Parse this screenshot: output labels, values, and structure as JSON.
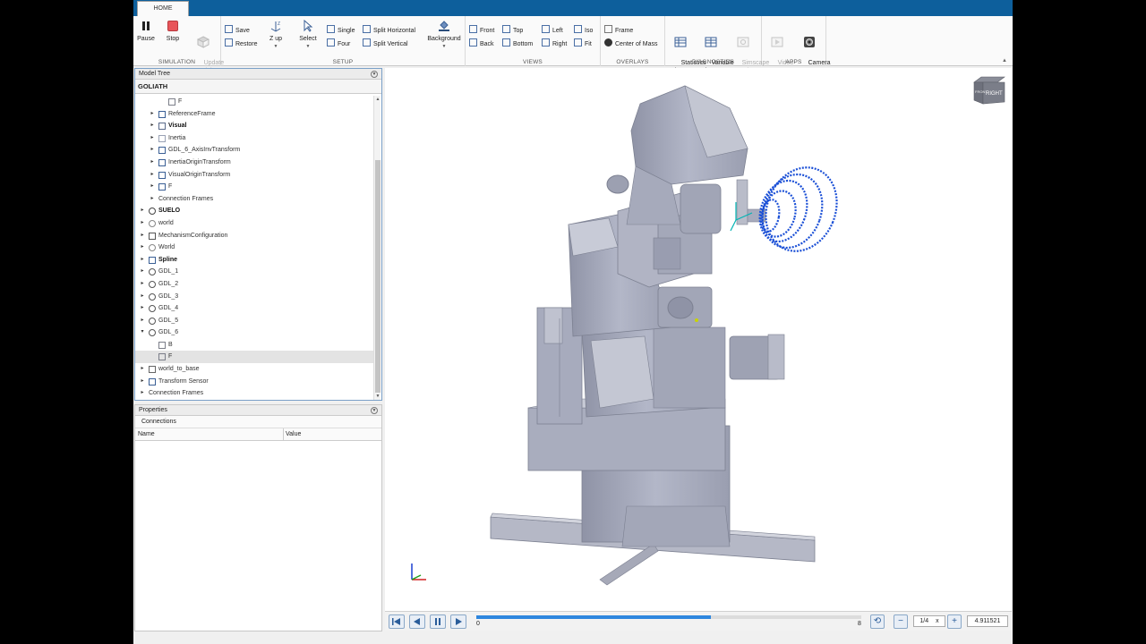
{
  "tabs": [
    {
      "label": "HOME"
    }
  ],
  "ribbon": {
    "simulation": {
      "label": "SIMULATION",
      "pause": "Pause",
      "stop": "Stop",
      "update_model": "Update\nModel"
    },
    "setup": {
      "label": "SETUP",
      "save": "Save",
      "restore": "Restore",
      "zup": "Z up",
      "select": "Select",
      "single": "Single",
      "four": "Four",
      "split_horizontal": "Split Horizontal",
      "split_vertical": "Split Vertical",
      "background": "Background"
    },
    "views": {
      "label": "VIEWS",
      "front": "Front",
      "back": "Back",
      "top": "Top",
      "bottom": "Bottom",
      "left": "Left",
      "right": "Right",
      "iso": "Iso",
      "fit": "Fit"
    },
    "overlays": {
      "label": "OVERLAYS",
      "frame": "Frame",
      "center_of_mass": "Center of Mass"
    },
    "diagnostics": {
      "label": "DIAGNOSTICS",
      "statistics_viewer": "Statistics\nViewer",
      "variable_viewer": "Variable\nViewer",
      "simscape_results": "Simscape\nResults"
    },
    "apps": {
      "label": "APPS",
      "video_creator": "Video\nCreator",
      "camera_manager": "Camera\nManager"
    }
  },
  "model_tree": {
    "title": "Model Tree",
    "root": "GOLIATH",
    "rows": [
      {
        "label": "F",
        "depth": 2,
        "arrow": "",
        "icon": "frame",
        "bold": false,
        "selected": false
      },
      {
        "label": "ReferenceFrame",
        "depth": 1,
        "arrow": "▸",
        "icon": "refframe",
        "bold": false,
        "selected": false
      },
      {
        "label": "Visual",
        "depth": 1,
        "arrow": "▸",
        "icon": "visual",
        "bold": true,
        "selected": false
      },
      {
        "label": "Inertia",
        "depth": 1,
        "arrow": "▸",
        "icon": "inertia",
        "bold": false,
        "selected": false
      },
      {
        "label": "GDL_6_AxisInvTransform",
        "depth": 1,
        "arrow": "▸",
        "icon": "transform",
        "bold": false,
        "selected": false
      },
      {
        "label": "InertiaOriginTransform",
        "depth": 1,
        "arrow": "▸",
        "icon": "transform",
        "bold": false,
        "selected": false
      },
      {
        "label": "VisualOriginTransform",
        "depth": 1,
        "arrow": "▸",
        "icon": "transform",
        "bold": false,
        "selected": false
      },
      {
        "label": "F",
        "depth": 1,
        "arrow": "▸",
        "icon": "frame2",
        "bold": false,
        "selected": false
      },
      {
        "label": "Connection Frames",
        "depth": 1,
        "arrow": "▸",
        "icon": "",
        "bold": false,
        "selected": false
      },
      {
        "label": "SUELO",
        "depth": 0,
        "arrow": "▸",
        "icon": "body",
        "bold": true,
        "selected": false
      },
      {
        "label": "world",
        "depth": 0,
        "arrow": "▸",
        "icon": "world",
        "bold": false,
        "selected": false
      },
      {
        "label": "MechanismConfiguration",
        "depth": 0,
        "arrow": "▸",
        "icon": "mech",
        "bold": false,
        "selected": false
      },
      {
        "label": "World",
        "depth": 0,
        "arrow": "▸",
        "icon": "world",
        "bold": false,
        "selected": false
      },
      {
        "label": "Spline",
        "depth": 0,
        "arrow": "▸",
        "icon": "spline",
        "bold": true,
        "selected": false
      },
      {
        "label": "GDL_1",
        "depth": 0,
        "arrow": "▸",
        "icon": "joint",
        "bold": false,
        "selected": false
      },
      {
        "label": "GDL_2",
        "depth": 0,
        "arrow": "▸",
        "icon": "joint",
        "bold": false,
        "selected": false
      },
      {
        "label": "GDL_3",
        "depth": 0,
        "arrow": "▸",
        "icon": "joint",
        "bold": false,
        "selected": false
      },
      {
        "label": "GDL_4",
        "depth": 0,
        "arrow": "▸",
        "icon": "joint",
        "bold": false,
        "selected": false
      },
      {
        "label": "GDL_5",
        "depth": 0,
        "arrow": "▸",
        "icon": "joint",
        "bold": false,
        "selected": false
      },
      {
        "label": "GDL_6",
        "depth": 0,
        "arrow": "▾",
        "icon": "joint",
        "bold": false,
        "selected": false
      },
      {
        "label": "B",
        "depth": 1,
        "arrow": "",
        "icon": "frame",
        "bold": false,
        "selected": false
      },
      {
        "label": "F",
        "depth": 1,
        "arrow": "",
        "icon": "frame",
        "bold": false,
        "selected": true
      },
      {
        "label": "world_to_base",
        "depth": 0,
        "arrow": "▸",
        "icon": "weld",
        "bold": false,
        "selected": false
      },
      {
        "label": "Transform Sensor",
        "depth": 0,
        "arrow": "▸",
        "icon": "sensor",
        "bold": false,
        "selected": false
      },
      {
        "label": "Connection Frames",
        "depth": 0,
        "arrow": "▸",
        "icon": "",
        "bold": false,
        "selected": false
      }
    ]
  },
  "properties": {
    "title": "Properties",
    "connections": "Connections",
    "col_name": "Name",
    "col_value": "Value"
  },
  "view_cube": {
    "face_front": "FRONT",
    "face_right": "RIGHT"
  },
  "playback": {
    "progress_fraction": 0.61,
    "start_label": "0",
    "end_label": "8",
    "speed": "1/4",
    "speed_suffix": "x",
    "time": "4.911521"
  },
  "colors": {
    "tab_bar": "#0d5f9c",
    "robot_body": "#a7abbd",
    "trajectory": "#1a4fd6"
  },
  "icons": {
    "pause": "pause-icon",
    "stop": "stop-icon",
    "update": "update-model-icon",
    "camera": "camera-icon"
  }
}
